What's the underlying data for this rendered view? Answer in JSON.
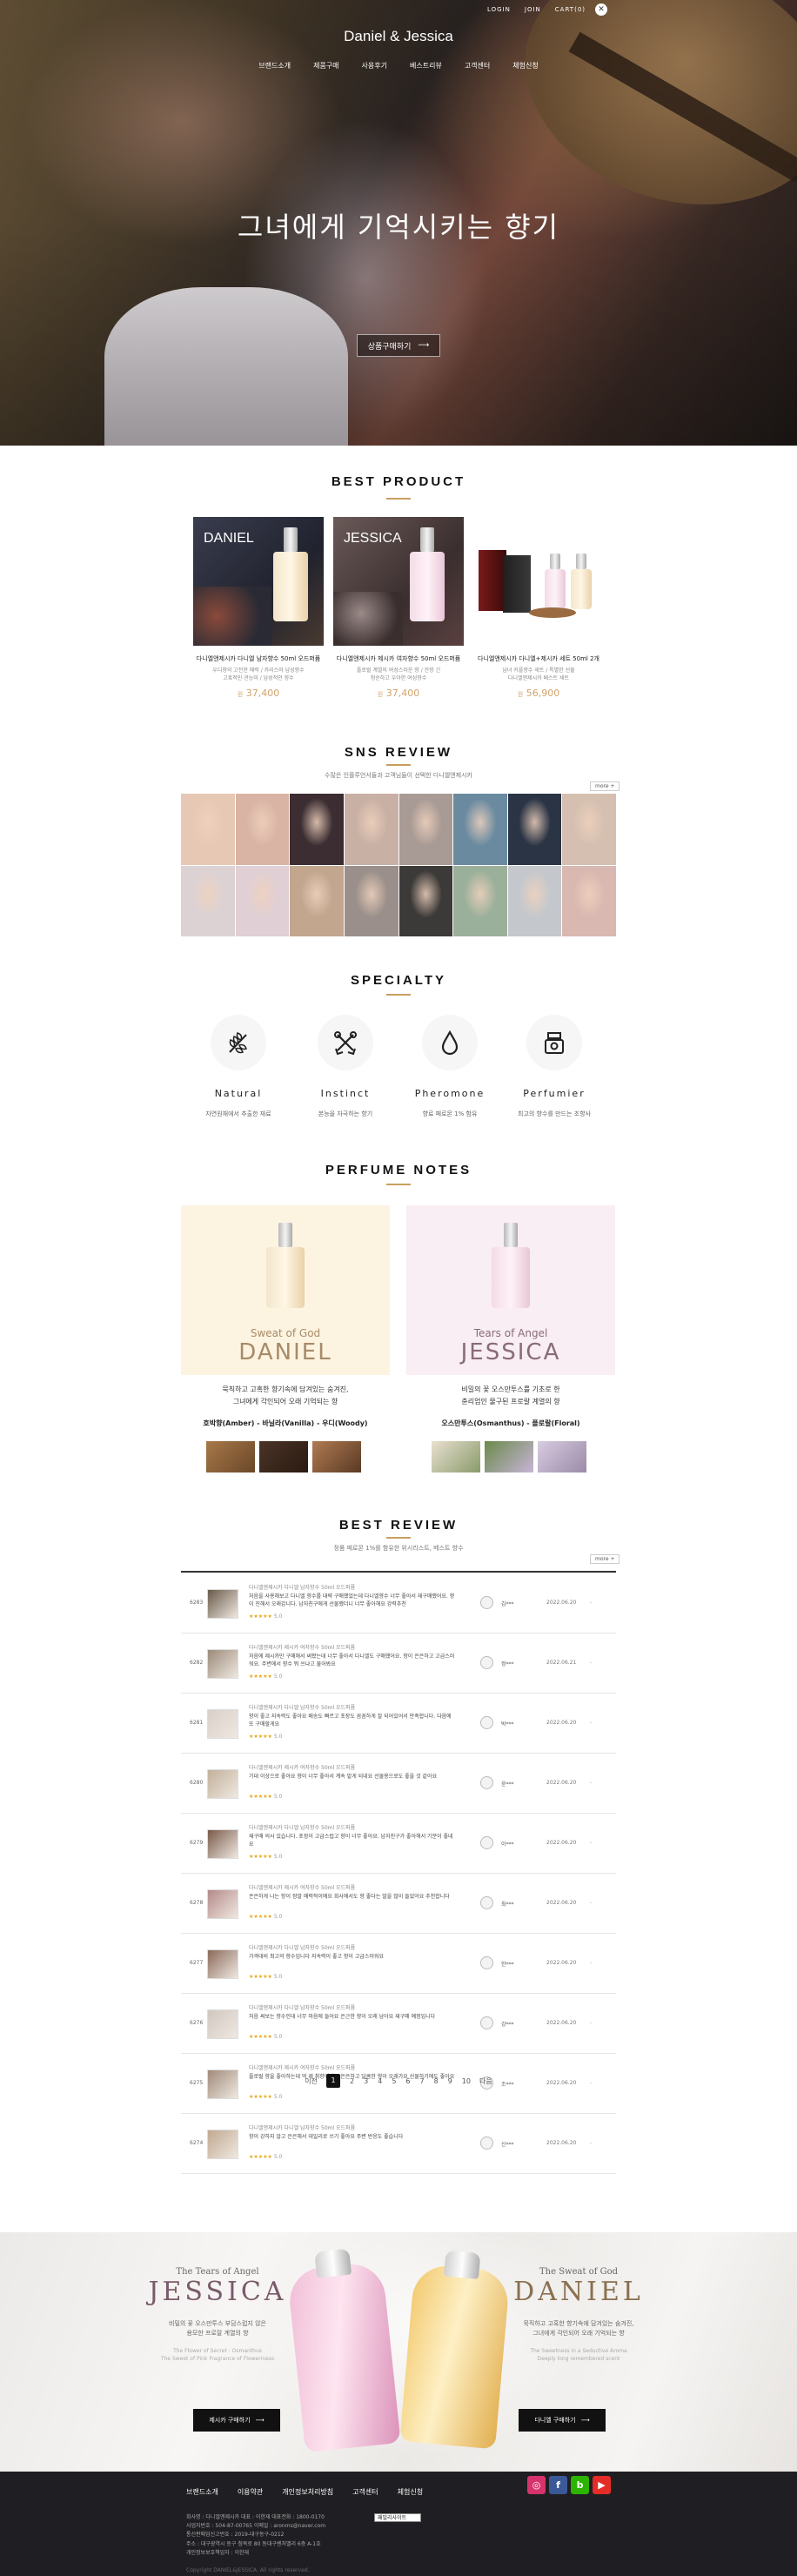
{
  "header": {
    "top_links": [
      "LOGIN",
      "JOIN",
      "CART"
    ],
    "cart_count": "0",
    "brand": "Daniel & Jessica",
    "nav": [
      "브랜드소개",
      "제품구매",
      "사용후기",
      "베스트리뷰",
      "고객센터",
      "체험신청"
    ],
    "hero_copy": "그녀에게 기억시키는 향기",
    "hero_button": "상품구매하기"
  },
  "best_product": {
    "title": "BEST PRODUCT",
    "items": [
      {
        "label": "DANIEL",
        "name": "다니엘앤제시카 다니엘 남자향수 50ml 오드퍼퓸",
        "desc": "우디향의 고전한 매력 / 카리스마 남성향수\n고혹적인 관능미 / 남성적인 향수",
        "price": "37,400",
        "unit": "원"
      },
      {
        "label": "JESSICA",
        "name": "다니엘앤제시카 제시카 여자향수 50ml 오드퍼퓸",
        "desc": "플로럴 계열의 여성스러운 향 / 잔향 긴\n청순하고 우아한 여성향수",
        "price": "37,400",
        "unit": "원"
      },
      {
        "label": "",
        "name": "다니엘앤제시카 다니엘+제시카 세트 50ml 2개",
        "desc": "남녀 커플향수 세트 / 특별한 선물\n다니엘앤제시카 베스트 세트",
        "price": "56,900",
        "unit": "원"
      }
    ]
  },
  "sns": {
    "title": "SNS REVIEW",
    "sub": "수많은 인플루언서들과 고객님들이 선택한 다니엘앤제시카",
    "more": "more +",
    "tiles": [
      "#e6c8b4",
      "#d9b4a4",
      "#3b2d32",
      "#c8b0a4",
      "#a89a94",
      "#6a8aa0",
      "#2a3444",
      "#d4bfb0",
      "#dcd2d4",
      "#e0cfd4",
      "#c2a68e",
      "#9a8f8a",
      "#3c3a38",
      "#9bb09a",
      "#c4c8cc",
      "#d8b8b0"
    ]
  },
  "specialty": {
    "title": "SPECIALTY",
    "items": [
      {
        "title": "Natural",
        "desc": "자연원재에서 추출한 재료",
        "icon": "leaf-icon"
      },
      {
        "title": "Instinct",
        "desc": "본능을 자극하는 향기",
        "icon": "crossed-arrows-icon"
      },
      {
        "title": "Pheromone",
        "desc": "향료 페로몬 1% 함유",
        "icon": "drop-icon"
      },
      {
        "title": "Perfumier",
        "desc": "최고의 향수를 만드는 조향사",
        "icon": "perfume-bottle-icon"
      }
    ]
  },
  "notes": {
    "title": "PERFUME NOTES",
    "daniel": {
      "sub": "Sweat of God",
      "name": "DANIEL",
      "desc": "묵직하고 고혹한 향기속에 담겨있는 숨겨진,\n그녀에게 각인되어 오래 기억되는 향",
      "pair": "호박향(Amber) - 바닐라(Vanilla) - 우디(Woody)",
      "color": "#a88a68",
      "bg": "#fcf4e0"
    },
    "jessica": {
      "sub": "Tears of Angel",
      "name": "JESSICA",
      "desc": "비밀의 꽃 오스만투스를 기초로 한\n츈리엄인 물구된 프로랄 계열의 향",
      "pair": "오스만투스(Osmanthus) - 플로랄(Floral)",
      "color": "#8a6a7a",
      "bg": "#f8eef3"
    }
  },
  "best_review": {
    "title": "BEST REVIEW",
    "sub": "정품 페로몬 1%를 함유한 위시리스트, 베스트 향수",
    "more": "more +",
    "rows": [
      {
        "num": "6283",
        "prod": "다니엘앤제시카 다니엘 남자향수 50ml 오드퍼퓸",
        "text": "처음을 사용해보고 다니엘 향수를 대략 구매했었는데 다니엘향수 너무 좋아서 재구매했어요. 향이 진해서 오래갑니다. 남자친구에게 선물했더니 너무 좋아해요 강력추천",
        "stars": "★★★★★",
        "score": "5.0",
        "user": "김***",
        "date": "2022.06.20",
        "dash": "-"
      },
      {
        "num": "6282",
        "prod": "다니엘앤제시카 제시카 여자향수 50ml 오드퍼퓸",
        "text": "처음에 제시카만 구매해서 써봤는데 너무 좋아서 다니엘도 구매했어요. 향이 은은하고 고급스러워요. 주변에서 향수 뭐 쓰냐고 물어봐요",
        "stars": "★★★★★",
        "score": "5.0",
        "user": "정***",
        "date": "2022.06.21",
        "dash": "-"
      },
      {
        "num": "6281",
        "prod": "다니엘앤제시카 다니엘 남자향수 50ml 오드퍼퓸",
        "text": "향이 좋고 지속력도 좋아요 배송도 빠르고 포장도 꼼꼼하게 잘 되어있어서 만족합니다. 다음에 또 구매할게요",
        "stars": "★★★★★",
        "score": "5.0",
        "user": "박***",
        "date": "2022.06.20",
        "dash": "-"
      },
      {
        "num": "6280",
        "prod": "다니엘앤제시카 제시카 여자향수 50ml 오드퍼퓸",
        "text": "기대 이상으로 좋아요 향이 너무 좋아서 계속 맡게 되네요 선물용으로도 좋을 것 같아요",
        "stars": "★★★★★",
        "score": "5.0",
        "user": "윤***",
        "date": "2022.06.20",
        "dash": "-"
      },
      {
        "num": "6279",
        "prod": "다니엘앤제시카 다니엘 남자향수 50ml 오드퍼퓸",
        "text": "재구매 의사 있습니다. 포장이 고급스럽고 향이 너무 좋아요. 남자친구가 좋아해서 기분이 좋네요",
        "stars": "★★★★★",
        "score": "5.0",
        "user": "이***",
        "date": "2022.06.20",
        "dash": "-"
      },
      {
        "num": "6278",
        "prod": "다니엘앤제시카 제시카 여자향수 50ml 오드퍼퓸",
        "text": "은은하게 나는 향이 정말 매력적이에요 회사에서도 향 좋다는 말을 많이 들었어요 추천합니다",
        "stars": "★★★★★",
        "score": "5.0",
        "user": "최***",
        "date": "2022.06.20",
        "dash": "-"
      },
      {
        "num": "6277",
        "prod": "다니엘앤제시카 다니엘 남자향수 50ml 오드퍼퓸",
        "text": "가격대비 최고의 향수입니다 지속력이 좋고 향이 고급스러워요",
        "stars": "★★★★★",
        "score": "5.0",
        "user": "한***",
        "date": "2022.06.20",
        "dash": "-"
      },
      {
        "num": "6276",
        "prod": "다니엘앤제시카 다니엘 남자향수 50ml 오드퍼퓸",
        "text": "처음 써보는 향수인데 너무 마음에 들어요 은근한 향이 오래 남아요 재구매 예정입니다",
        "stars": "★★★★★",
        "score": "5.0",
        "user": "강***",
        "date": "2022.06.20",
        "dash": "-"
      },
      {
        "num": "6275",
        "prod": "다니엘앤제시카 제시카 여자향수 50ml 오드퍼퓸",
        "text": "플로럴 향을 좋아하는데 딱 제 취향이에요 은은하고 달콤한 향이 오래가요 선물하기에도 좋아요",
        "stars": "★★★★★",
        "score": "5.0",
        "user": "조***",
        "date": "2022.06.20",
        "dash": "-"
      },
      {
        "num": "6274",
        "prod": "다니엘앤제시카 다니엘 남자향수 50ml 오드퍼퓸",
        "text": "향이 강하지 않고 은은해서 데일리로 쓰기 좋아요 주변 반응도 좋습니다",
        "stars": "★★★★★",
        "score": "5.0",
        "user": "신***",
        "date": "2022.06.20",
        "dash": "-"
      }
    ],
    "thumbs": [
      "#6a5a4a",
      "#9b8a7a",
      "#d8d0c8",
      "#c2b09a",
      "#7a5a4a",
      "#b48a8a",
      "#8a6a5a",
      "#d0c8c0",
      "#a08a7a",
      "#c0a890"
    ]
  },
  "pager": {
    "prev": "이전",
    "next": "다음",
    "pages": [
      "1",
      "2",
      "3",
      "4",
      "5",
      "6",
      "7",
      "8",
      "9",
      "10"
    ],
    "current": "1"
  },
  "banner": {
    "jessica": {
      "sub": "The Tears of Angel",
      "name": "JESSICA",
      "kr": "비밀의 꽃 오스만투스 부담스럽지 않은\n용모한 프로랄 계열의 향",
      "en": "The Flower of Secret : Osmanthus\nThe Sweet of Pink Fragrance of Floweriness",
      "btn": "제시카 구매하기"
    },
    "daniel": {
      "sub": "The Sweat of God",
      "name": "DANIEL",
      "kr": "묵직하고 고혹한 향기속에 담겨있는 숨겨진,\n그녀에게 각인되어 오래 기억되는 향",
      "en": "The Sweetness in a Seductive Aroma\nDeeply long remembered scent",
      "btn": "다니엘 구매하기"
    }
  },
  "footer": {
    "nav": [
      "브랜드소개",
      "이용약관",
      "개인정보처리방침",
      "고객센터",
      "체험신청"
    ],
    "select": "패밀리사이트",
    "info": [
      "회사명 : 다니엘앤제시카   대표 : 이한재   대표전화 : 1800-0170",
      "사업자번호 : 504-87-00765   이메일 : aronms@naver.com",
      "통신판매업신고번호 : 2019-대구동구-0212",
      "주소 : 대구광역시 동구 첨복로 80 동대구벤처밸리 6층 A-1호",
      "개인정보보호책임자 : 이한재"
    ],
    "copyright": "Copyright DANIEL&JESSICA. All rights reserved.",
    "social": [
      {
        "icon": "instagram-icon",
        "glyph": "◎",
        "color": "#d6336c"
      },
      {
        "icon": "facebook-icon",
        "glyph": "f",
        "color": "#3b5998"
      },
      {
        "icon": "blog-icon",
        "glyph": "b",
        "color": "#2db400"
      },
      {
        "icon": "youtube-icon",
        "glyph": "▶",
        "color": "#e52d27"
      }
    ]
  }
}
